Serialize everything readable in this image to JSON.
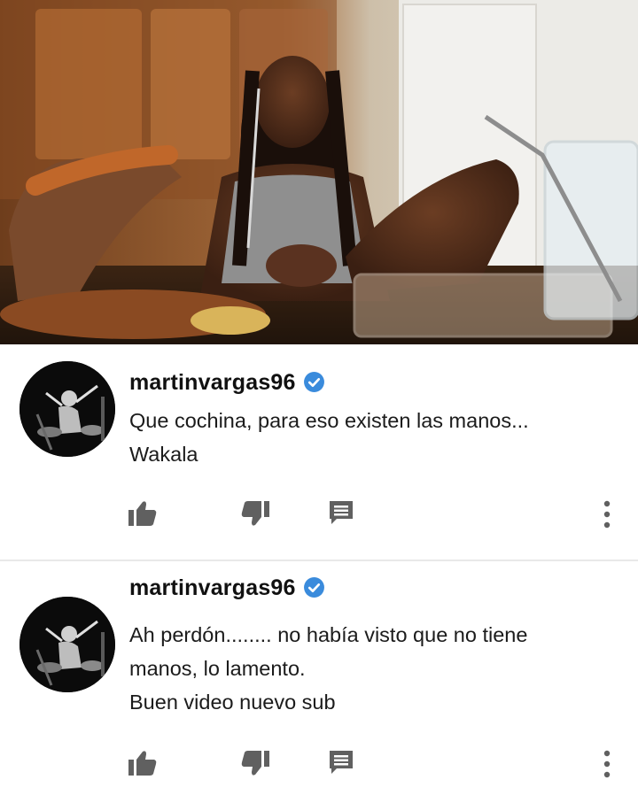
{
  "comments": [
    {
      "username": "martinvargas96",
      "verified": true,
      "lines": [
        "Que cochina, para eso existen las manos...",
        "Wakala"
      ],
      "actions": [
        "thumbs-up-icon",
        "thumbs-down-icon",
        "reply-icon",
        "more-vert-icon"
      ]
    },
    {
      "username": "martinvargas96",
      "verified": true,
      "lines": [
        "Ah perdón........ no había visto que no tiene",
        "manos, lo lamento.",
        "Buen video nuevo sub"
      ],
      "actions": [
        "thumbs-up-icon",
        "thumbs-down-icon",
        "reply-icon",
        "more-vert-icon"
      ]
    }
  ],
  "colors": {
    "verified_badge": "#3a8bdc",
    "icon_gray": "#606060",
    "text": "#1b1b1b"
  }
}
